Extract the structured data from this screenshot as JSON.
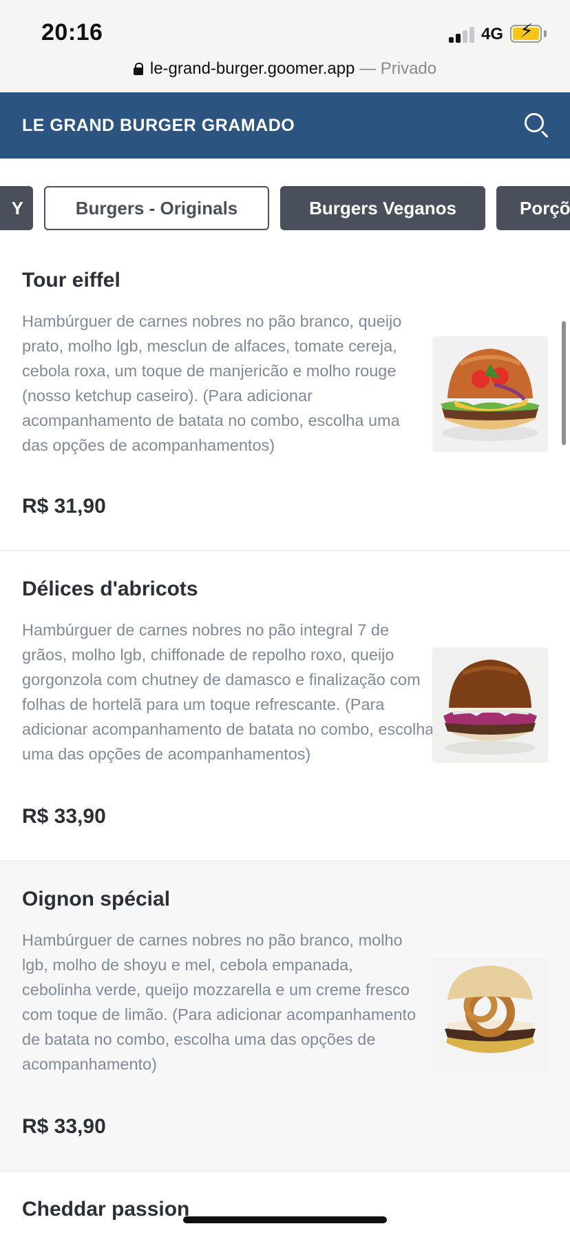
{
  "status_bar": {
    "time": "20:16",
    "network": "4G",
    "battery": "charging"
  },
  "browser": {
    "url": "le-grand-burger.goomer.app",
    "private_label": "— Privado"
  },
  "header": {
    "title": "LE GRAND BURGER GRAMADO",
    "search_icon": "search-icon"
  },
  "tabs": [
    {
      "label": "Y"
    },
    {
      "label": "Burgers - Originals"
    },
    {
      "label": "Burgers Veganos"
    },
    {
      "label": "Porçõ"
    }
  ],
  "items": [
    {
      "name": "Tour eiffel",
      "description": "Hambúrguer de carnes nobres no pão branco, queijo prato, molho lgb, mesclun de alfaces, tomate cereja, cebola roxa, um toque de manjericão e molho rouge (nosso ketchup caseiro). (Para adicionar acompanhamento de batata no combo, escolha uma das opções de acompanhamentos)",
      "price": "R$ 31,90"
    },
    {
      "name": "Délices d'abricots",
      "description": "Hambúrguer de carnes nobres no pão integral 7 de grãos, molho lgb, chiffonade de repolho roxo, queijo gorgonzola com chutney de damasco e finalização com folhas de hortelã para um toque refrescante. (Para adicionar acompanhamento de batata no combo, escolha uma das opções de acompanhamentos)",
      "price": "R$ 33,90"
    },
    {
      "name": "Oignon spécial",
      "description": "Hambúrguer de carnes nobres no pão branco, molho lgb, molho de shoyu e mel, cebola empanada, cebolinha verde, queijo mozzarella e um creme fresco com toque de limão. (Para adicionar acompanhamento de batata no combo, escolha uma das opções de acompanhamento)",
      "price": "R$ 33,90"
    },
    {
      "name": "Cheddar passion"
    }
  ],
  "colors": {
    "header": "#2b5580",
    "tab_dark": "#4a505b",
    "description": "#7f8a96"
  }
}
